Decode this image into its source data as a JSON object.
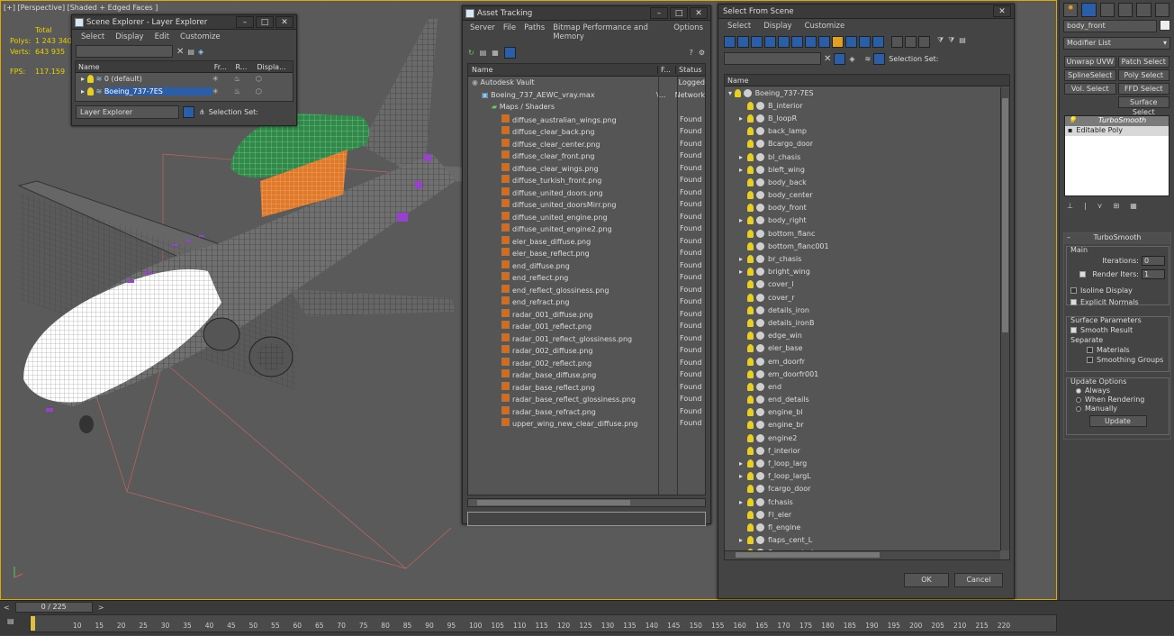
{
  "viewport": {
    "label": "[+] [Perspective] [Shaded + Edged Faces ]",
    "stats": {
      "total_label": "Total",
      "polys_label": "Polys:",
      "polys": "1 243 340",
      "verts_label": "Verts:",
      "verts": "643 935",
      "fps_label": "FPS:",
      "fps": "117.159"
    }
  },
  "scene_explorer": {
    "title": "Scene Explorer - Layer Explorer",
    "menu": [
      "Select",
      "Display",
      "Edit",
      "Customize"
    ],
    "columns": [
      "Name",
      "Fr...",
      "R...",
      "Displa..."
    ],
    "rows": [
      "0 (default)",
      "Boeing_737-7ES"
    ],
    "footer_dropdown": "Layer Explorer",
    "selection_set": "Selection Set:"
  },
  "asset_tracking": {
    "title": "Asset Tracking",
    "menu": [
      "Server",
      "File",
      "Paths",
      "Bitmap Performance and Memory",
      "Options"
    ],
    "columns": [
      "Name",
      "F...",
      "Status"
    ],
    "rows": [
      {
        "name": "Autodesk Vault",
        "f": "",
        "status": "Logged",
        "level": 0,
        "type": "vault"
      },
      {
        "name": "Boeing_737_AEWC_vray.max",
        "f": "\\...",
        "status": "Network",
        "level": 1,
        "type": "max"
      },
      {
        "name": "Maps / Shaders",
        "f": "",
        "status": "",
        "level": 2,
        "type": "folder"
      },
      {
        "name": "diffuse_australian_wings.png",
        "f": "",
        "status": "Found",
        "level": 3,
        "type": "map"
      },
      {
        "name": "diffuse_clear_back.png",
        "f": "",
        "status": "Found",
        "level": 3,
        "type": "map"
      },
      {
        "name": "diffuse_clear_center.png",
        "f": "",
        "status": "Found",
        "level": 3,
        "type": "map"
      },
      {
        "name": "diffuse_clear_front.png",
        "f": "",
        "status": "Found",
        "level": 3,
        "type": "map"
      },
      {
        "name": "diffuse_clear_wings.png",
        "f": "",
        "status": "Found",
        "level": 3,
        "type": "map"
      },
      {
        "name": "diffuse_turkish_front.png",
        "f": "",
        "status": "Found",
        "level": 3,
        "type": "map"
      },
      {
        "name": "diffuse_united_doors.png",
        "f": "",
        "status": "Found",
        "level": 3,
        "type": "map"
      },
      {
        "name": "diffuse_united_doorsMirr.png",
        "f": "",
        "status": "Found",
        "level": 3,
        "type": "map"
      },
      {
        "name": "diffuse_united_engine.png",
        "f": "",
        "status": "Found",
        "level": 3,
        "type": "map"
      },
      {
        "name": "diffuse_united_engine2.png",
        "f": "",
        "status": "Found",
        "level": 3,
        "type": "map"
      },
      {
        "name": "eler_base_diffuse.png",
        "f": "",
        "status": "Found",
        "level": 3,
        "type": "map"
      },
      {
        "name": "eler_base_reflect.png",
        "f": "",
        "status": "Found",
        "level": 3,
        "type": "map"
      },
      {
        "name": "end_diffuse.png",
        "f": "",
        "status": "Found",
        "level": 3,
        "type": "map"
      },
      {
        "name": "end_reflect.png",
        "f": "",
        "status": "Found",
        "level": 3,
        "type": "map"
      },
      {
        "name": "end_reflect_glossiness.png",
        "f": "",
        "status": "Found",
        "level": 3,
        "type": "map"
      },
      {
        "name": "end_refract.png",
        "f": "",
        "status": "Found",
        "level": 3,
        "type": "map"
      },
      {
        "name": "radar_001_diffuse.png",
        "f": "",
        "status": "Found",
        "level": 3,
        "type": "map"
      },
      {
        "name": "radar_001_reflect.png",
        "f": "",
        "status": "Found",
        "level": 3,
        "type": "map"
      },
      {
        "name": "radar_001_reflect_glossiness.png",
        "f": "",
        "status": "Found",
        "level": 3,
        "type": "map"
      },
      {
        "name": "radar_002_diffuse.png",
        "f": "",
        "status": "Found",
        "level": 3,
        "type": "map"
      },
      {
        "name": "radar_002_reflect.png",
        "f": "",
        "status": "Found",
        "level": 3,
        "type": "map"
      },
      {
        "name": "radar_base_diffuse.png",
        "f": "",
        "status": "Found",
        "level": 3,
        "type": "map"
      },
      {
        "name": "radar_base_reflect.png",
        "f": "",
        "status": "Found",
        "level": 3,
        "type": "map"
      },
      {
        "name": "radar_base_reflect_glossiness.png",
        "f": "",
        "status": "Found",
        "level": 3,
        "type": "map"
      },
      {
        "name": "radar_base_refract.png",
        "f": "",
        "status": "Found",
        "level": 3,
        "type": "map"
      },
      {
        "name": "upper_wing_new_clear_diffuse.png",
        "f": "",
        "status": "Found",
        "level": 3,
        "type": "map"
      }
    ]
  },
  "select_from_scene": {
    "title": "Select From Scene",
    "menu": [
      "Select",
      "Display",
      "Customize"
    ],
    "selection_set": "Selection Set:",
    "column": "Name",
    "root": "Boeing_737-7ES",
    "items": [
      {
        "name": "B_interior",
        "exp": false
      },
      {
        "name": "B_loopR",
        "exp": true
      },
      {
        "name": "back_lamp",
        "exp": false
      },
      {
        "name": "Bcargo_door",
        "exp": false
      },
      {
        "name": "bl_chasis",
        "exp": true
      },
      {
        "name": "bleft_wing",
        "exp": true
      },
      {
        "name": "body_back",
        "exp": false
      },
      {
        "name": "body_center",
        "exp": false
      },
      {
        "name": "body_front",
        "exp": false
      },
      {
        "name": "body_right",
        "exp": true
      },
      {
        "name": "bottom_flanc",
        "exp": false
      },
      {
        "name": "bottom_flanc001",
        "exp": false
      },
      {
        "name": "br_chasis",
        "exp": true
      },
      {
        "name": "bright_wing",
        "exp": true
      },
      {
        "name": "cover_l",
        "exp": false
      },
      {
        "name": "cover_r",
        "exp": false
      },
      {
        "name": "details_iron",
        "exp": false
      },
      {
        "name": "details_ironB",
        "exp": false
      },
      {
        "name": "edge_win",
        "exp": false
      },
      {
        "name": "eler_base",
        "exp": false
      },
      {
        "name": "em_doorfr",
        "exp": false
      },
      {
        "name": "em_doorfr001",
        "exp": false
      },
      {
        "name": "end",
        "exp": false
      },
      {
        "name": "end_details",
        "exp": false
      },
      {
        "name": "engine_bl",
        "exp": false
      },
      {
        "name": "engine_br",
        "exp": false
      },
      {
        "name": "engine2",
        "exp": false
      },
      {
        "name": "f_interior",
        "exp": false
      },
      {
        "name": "f_loop_larg",
        "exp": true
      },
      {
        "name": "f_loop_largL",
        "exp": true
      },
      {
        "name": "fcargo_door",
        "exp": false
      },
      {
        "name": "fchasis",
        "exp": true
      },
      {
        "name": "Fl_eler",
        "exp": false
      },
      {
        "name": "fl_engine",
        "exp": false
      },
      {
        "name": "flaps_cent_L",
        "exp": true
      },
      {
        "name": "flaps_cent_rL",
        "exp": true
      }
    ],
    "ok": "OK",
    "cancel": "Cancel"
  },
  "right_panel": {
    "object_name": "body_front",
    "modifier_list": "Modifier List",
    "buttons": [
      "Unwrap UVW",
      "Patch Select",
      "SplineSelect",
      "Poly Select",
      "Vol. Select",
      "FFD Select",
      "Surface Select"
    ],
    "stack": [
      "TurboSmooth",
      "Editable Poly"
    ],
    "rollout_title": "TurboSmooth",
    "main_label": "Main",
    "iterations_label": "Iterations:",
    "iterations": "0",
    "render_iters_label": "Render Iters:",
    "render_iters": "1",
    "isoline": "Isoline Display",
    "explicit": "Explicit Normals",
    "surface_params": "Surface Parameters",
    "smooth_result": "Smooth Result",
    "separate": "Separate",
    "materials": "Materials",
    "smoothing_groups": "Smoothing Groups",
    "update_options": "Update Options",
    "always": "Always",
    "when_rendering": "When Rendering",
    "manually": "Manually",
    "update": "Update"
  },
  "timeline": {
    "frame": "0 / 225",
    "ticks": [
      "10",
      "15",
      "20",
      "25",
      "30",
      "35",
      "40",
      "45",
      "50",
      "55",
      "60",
      "65",
      "70",
      "75",
      "80",
      "85",
      "90",
      "95",
      "100",
      "105",
      "110",
      "115",
      "120",
      "125",
      "130",
      "135",
      "140",
      "145",
      "150",
      "155",
      "160",
      "165",
      "170",
      "175",
      "180",
      "185",
      "190",
      "195",
      "200",
      "205",
      "210",
      "215",
      "220"
    ]
  },
  "colors": {
    "accent": "#e0a800",
    "selected": "#2b5ea8",
    "radar_green": "#2f8a4a",
    "radar_orange": "#e07a2a",
    "purple": "#9a40d0"
  }
}
